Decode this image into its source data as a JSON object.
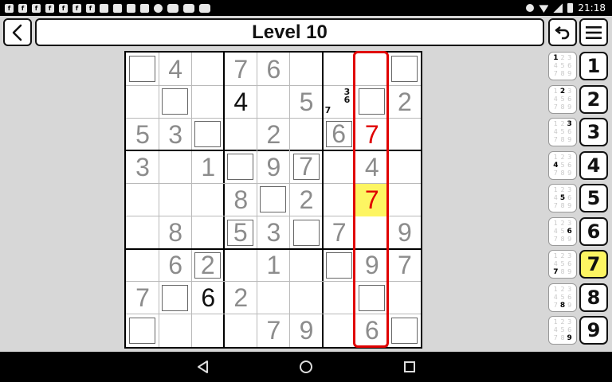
{
  "status_bar": {
    "time": "21:18",
    "notification_icons": [
      "f",
      "f",
      "f",
      "f",
      "f",
      "f",
      "f",
      "img",
      "mail",
      "mail",
      "play",
      "cat",
      "yt",
      "yt",
      "yt"
    ]
  },
  "header": {
    "title": "Level 10",
    "back_icon": "chevron-left-icon",
    "undo_icon": "undo-icon",
    "menu_icon": "menu-icon"
  },
  "board": {
    "rows": [
      [
        "",
        "4",
        "",
        "7",
        "6",
        "",
        "",
        "",
        ""
      ],
      [
        "",
        "",
        "",
        "4",
        "",
        "5",
        "",
        "",
        "2"
      ],
      [
        "5",
        "3",
        "",
        "",
        "2",
        "",
        "6",
        "7",
        ""
      ],
      [
        "3",
        "",
        "1",
        "",
        "9",
        "7",
        "",
        "4",
        ""
      ],
      [
        "",
        "",
        "",
        "8",
        "",
        "2",
        "",
        "7",
        ""
      ],
      [
        "",
        "8",
        "",
        "5",
        "3",
        "",
        "7",
        "",
        "9"
      ],
      [
        "",
        "6",
        "2",
        "",
        "1",
        "",
        "",
        "9",
        "7"
      ],
      [
        "7",
        "",
        "6",
        "2",
        "",
        "",
        "",
        "",
        ""
      ],
      [
        "",
        "",
        "",
        "",
        "7",
        "9",
        "",
        "6",
        ""
      ]
    ],
    "user_entered": [
      [
        1,
        3
      ],
      [
        7,
        2
      ]
    ],
    "red_digits": [
      [
        2,
        7
      ],
      [
        4,
        7
      ]
    ],
    "highlighted": [
      [
        4,
        7
      ]
    ],
    "selected_column": 7,
    "boxed_empty": [
      [
        0,
        0
      ],
      [
        0,
        8
      ],
      [
        1,
        1
      ],
      [
        1,
        7
      ],
      [
        2,
        2
      ],
      [
        3,
        3
      ],
      [
        4,
        4
      ],
      [
        5,
        5
      ],
      [
        6,
        6
      ],
      [
        7,
        1
      ],
      [
        7,
        7
      ],
      [
        8,
        0
      ],
      [
        8,
        8
      ]
    ],
    "boxed_filled": [
      [
        2,
        6
      ],
      [
        3,
        5
      ],
      [
        5,
        3
      ],
      [
        6,
        2
      ]
    ],
    "pencil_notes": [
      {
        "row": 1,
        "col": 6,
        "top": "3\n6",
        "bottom": "7"
      }
    ]
  },
  "candidate_buttons": [
    {
      "digit": 1,
      "grid": [
        "1",
        "2",
        "3",
        "4",
        "5",
        "6",
        "7",
        "8",
        "9"
      ]
    },
    {
      "digit": 2,
      "grid": [
        "1",
        "2",
        "3",
        "4",
        "5",
        "6",
        "7",
        "8",
        "9"
      ]
    },
    {
      "digit": 3,
      "grid": [
        "1",
        "2",
        "3",
        "4",
        "5",
        "6",
        "7",
        "8",
        "9"
      ]
    },
    {
      "digit": 4,
      "grid": [
        "1",
        "2",
        "3",
        "4",
        "5",
        "6",
        "7",
        "8",
        "9"
      ]
    },
    {
      "digit": 5,
      "grid": [
        "1",
        "2",
        "3",
        "4",
        "5",
        "6",
        "7",
        "8",
        "9"
      ]
    },
    {
      "digit": 6,
      "grid": [
        "1",
        "2",
        "3",
        "4",
        "5",
        "6",
        "7",
        "8",
        "9"
      ]
    },
    {
      "digit": 7,
      "grid": [
        "1",
        "2",
        "3",
        "4",
        "5",
        "6",
        "7",
        "8",
        "9"
      ]
    },
    {
      "digit": 8,
      "grid": [
        "1",
        "2",
        "3",
        "4",
        "5",
        "6",
        "7",
        "8",
        "9"
      ]
    },
    {
      "digit": 9,
      "grid": [
        "1",
        "2",
        "3",
        "4",
        "5",
        "6",
        "7",
        "8",
        "9"
      ]
    }
  ],
  "number_buttons": [
    "1",
    "2",
    "3",
    "4",
    "5",
    "6",
    "7",
    "8",
    "9"
  ],
  "selected_number": "7",
  "colors": {
    "selected_fill": "#fdf562",
    "error_red": "#e00000",
    "given_gray": "#8c8c8c",
    "user_black": "#111111"
  },
  "nav_bar": {
    "back_icon": "triangle-back-icon",
    "home_icon": "circle-home-icon",
    "recents_icon": "square-recents-icon"
  }
}
